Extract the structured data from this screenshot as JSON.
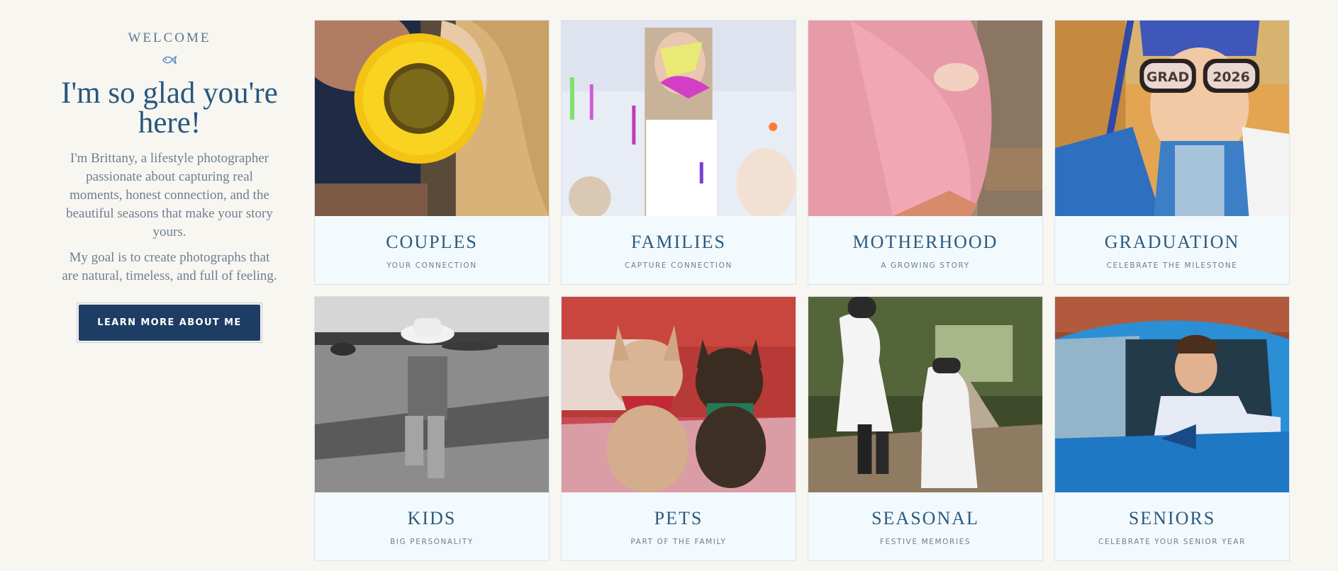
{
  "intro": {
    "eyebrow": "WELCOME",
    "flourish_icon": "fish-flourish-icon",
    "headline": "I'm so glad you're here!",
    "paragraph_1": "I'm Brittany, a lifestyle photographer passionate about capturing real moments, honest connection, and the beautiful seasons that make your story yours.",
    "paragraph_2": "My goal is to create photographs that are natural, timeless, and full of feeling.",
    "cta_label": "LEARN MORE ABOUT ME"
  },
  "colors": {
    "page_background": "#f8f6f1",
    "accent_navy": "#1d3d64",
    "heading_blue": "#27577f",
    "card_background": "#f3fafd"
  },
  "gallery": [
    {
      "title": "COUPLES",
      "subtitle": "YOUR CONNECTION",
      "photo": "couple kissing behind a sunflower"
    },
    {
      "title": "FAMILIES",
      "subtitle": "CAPTURE CONNECTION",
      "photo": "laughing woman covered in colorful paint"
    },
    {
      "title": "MOTHERHOOD",
      "subtitle": "A GROWING STORY",
      "photo": "pregnant belly in pink dress"
    },
    {
      "title": "GRADUATION",
      "subtitle": "CELEBRATE THE MILESTONE",
      "photo": "child in cap with GRAD 2026 glasses"
    },
    {
      "title": "KIDS",
      "subtitle": "BIG PERSONALITY",
      "photo": "black and white toddler in cowboy hat in pasture"
    },
    {
      "title": "PETS",
      "subtitle": "PART OF THE FAMILY",
      "photo": "two french bulldogs with bandanas"
    },
    {
      "title": "SEASONAL",
      "subtitle": "FESTIVE MEMORIES",
      "photo": "two people in ghost sheets on forest path"
    },
    {
      "title": "SENIORS",
      "subtitle": "CELEBRATE YOUR SENIOR YEAR",
      "photo": "young man leaning out of blue car"
    }
  ],
  "photo_labels": {
    "grad_glasses_left": "GRAD",
    "grad_glasses_right": "2026"
  }
}
